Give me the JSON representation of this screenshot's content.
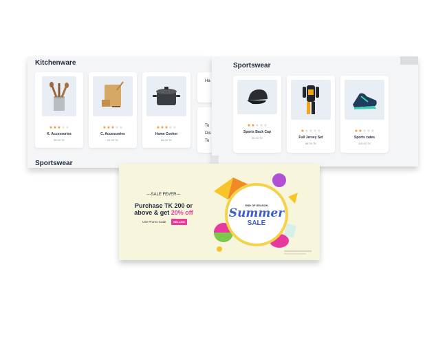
{
  "kitchen": {
    "title": "Kitchenware",
    "bottom_title": "Sportswear",
    "cut_labels": [
      "Ha",
      "To",
      "Dis",
      "To"
    ],
    "products": [
      {
        "name": "K. Accessories",
        "price": "35.00 TK",
        "rating": 3,
        "icon": "wooden-spoons-icon"
      },
      {
        "name": "C. Accessories",
        "price": "23.00 TK",
        "rating": 3,
        "icon": "cutting-board-icon"
      },
      {
        "name": "Home Cooker",
        "price": "68.00 TK",
        "rating": 3,
        "icon": "cooking-pot-icon"
      }
    ]
  },
  "sports": {
    "title": "Sportswear",
    "products": [
      {
        "name": "Sports Back Cap",
        "price": "45.00 TK",
        "rating": 2,
        "icon": "cap-icon"
      },
      {
        "name": "Full Jersey Set",
        "price": "88.00 TK",
        "rating": 1,
        "icon": "jersey-icon"
      },
      {
        "name": "Sports cates",
        "price": "119.00 TK",
        "rating": 2,
        "icon": "sneaker-icon"
      }
    ]
  },
  "banner": {
    "fever": "---SALE FEVER---",
    "line1": "Purchase TK 200 or",
    "line2_prefix": "above & get ",
    "line2_highlight": "20% off",
    "promo_label": "Use Promo Code",
    "promo_code": "SELL200",
    "badge_top": "END OF SEASON",
    "badge_script": "Summer",
    "badge_bottom": "SALE"
  },
  "colors": {
    "star": "#f08a24",
    "accent": "#e8399d",
    "badge_text": "#3b5fc4"
  }
}
